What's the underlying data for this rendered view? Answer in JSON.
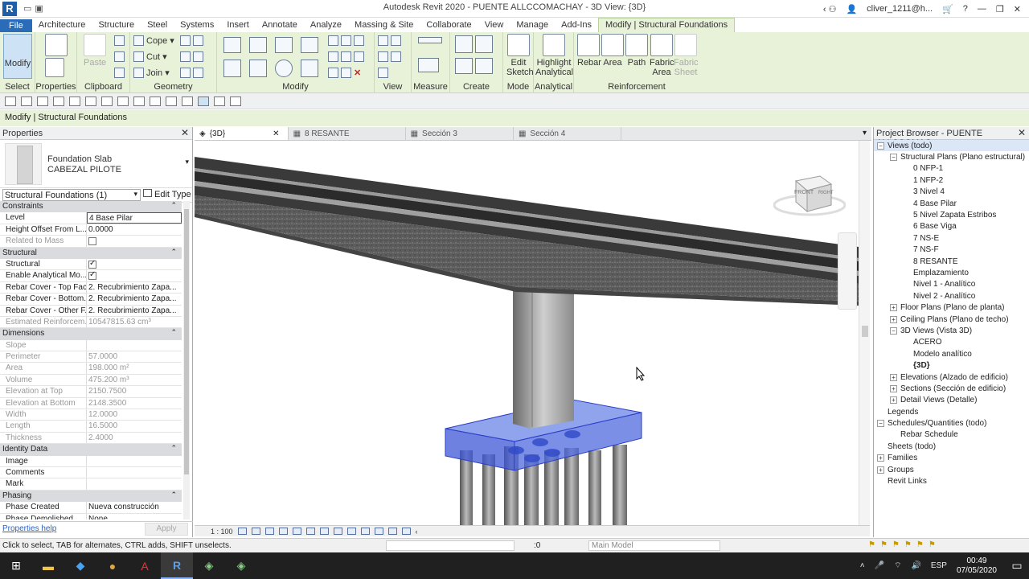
{
  "window": {
    "title": "Autodesk Revit 2020 - PUENTE ALLCCOMACHAY - 3D View: {3D}",
    "user": "cliver_1211@h...",
    "help": "?"
  },
  "tabs": [
    "File",
    "Architecture",
    "Structure",
    "Steel",
    "Systems",
    "Insert",
    "Annotate",
    "Analyze",
    "Massing & Site",
    "Collaborate",
    "View",
    "Manage",
    "Add-Ins",
    "Modify | Structural Foundations"
  ],
  "ribbon": {
    "select": {
      "modify": "Modify",
      "label": "Select"
    },
    "properties": {
      "label": "Properties"
    },
    "clipboard": {
      "paste": "Paste",
      "label": "Clipboard"
    },
    "geometry": {
      "cope": "Cope",
      "cut": "Cut",
      "join": "Join",
      "label": "Geometry"
    },
    "modify": {
      "label": "Modify"
    },
    "view": {
      "label": "View"
    },
    "measure": {
      "label": "Measure"
    },
    "create": {
      "label": "Create"
    },
    "mode": {
      "edit_sketch": "Edit Sketch",
      "label": "Mode"
    },
    "analytical": {
      "highlight": "Highlight Analytical",
      "label": "Analytical"
    },
    "reinforcement": {
      "rebar": "Rebar",
      "area": "Area",
      "path": "Path",
      "fabric_area": "Fabric Area",
      "fabric_sheet": "Fabric Sheet",
      "label": "Reinforcement"
    }
  },
  "options_bar": "Modify | Structural Foundations",
  "properties": {
    "title": "Properties",
    "family": "Foundation Slab",
    "type": "CABEZAL PILOTE",
    "instance_selector": "Structural Foundations (1)",
    "edit_type": "Edit Type",
    "sections": [
      {
        "name": "Constraints",
        "rows": [
          {
            "k": "Level",
            "v": "4 Base Pilar",
            "boxed": true
          },
          {
            "k": "Height Offset From L...",
            "v": "0.0000"
          },
          {
            "k": "Related to Mass",
            "v": "",
            "chk": "off",
            "ro": true
          }
        ]
      },
      {
        "name": "Structural",
        "rows": [
          {
            "k": "Structural",
            "v": "",
            "chk": "on"
          },
          {
            "k": "Enable Analytical Mo...",
            "v": "",
            "chk": "on"
          },
          {
            "k": "Rebar Cover - Top Face",
            "v": "2. Recubrimiento Zapa..."
          },
          {
            "k": "Rebar Cover - Bottom...",
            "v": "2. Recubrimiento Zapa..."
          },
          {
            "k": "Rebar Cover - Other F...",
            "v": "2. Recubrimiento Zapa..."
          },
          {
            "k": "Estimated Reinforcem...",
            "v": "10547815.63 cm³",
            "ro": true
          }
        ]
      },
      {
        "name": "Dimensions",
        "rows": [
          {
            "k": "Slope",
            "v": "",
            "ro": true
          },
          {
            "k": "Perimeter",
            "v": "57.0000",
            "ro": true
          },
          {
            "k": "Area",
            "v": "198.000 m²",
            "ro": true
          },
          {
            "k": "Volume",
            "v": "475.200 m³",
            "ro": true
          },
          {
            "k": "Elevation at Top",
            "v": "2150.7500",
            "ro": true
          },
          {
            "k": "Elevation at Bottom",
            "v": "2148.3500",
            "ro": true
          },
          {
            "k": "Width",
            "v": "12.0000",
            "ro": true
          },
          {
            "k": "Length",
            "v": "16.5000",
            "ro": true
          },
          {
            "k": "Thickness",
            "v": "2.4000",
            "ro": true
          }
        ]
      },
      {
        "name": "Identity Data",
        "rows": [
          {
            "k": "Image",
            "v": ""
          },
          {
            "k": "Comments",
            "v": ""
          },
          {
            "k": "Mark",
            "v": ""
          }
        ]
      },
      {
        "name": "Phasing",
        "rows": [
          {
            "k": "Phase Created",
            "v": "Nueva construcción"
          },
          {
            "k": "Phase Demolished",
            "v": "None"
          }
        ]
      }
    ],
    "help_link": "Properties help",
    "apply": "Apply"
  },
  "view_tabs": [
    {
      "label": "{3D}",
      "active": true
    },
    {
      "label": "8 RESANTE",
      "active": false
    },
    {
      "label": "Sección 3",
      "active": false
    },
    {
      "label": "Sección 4",
      "active": false
    }
  ],
  "viewcube": {
    "front": "FRONT",
    "right": "RIGHT"
  },
  "view_control": {
    "scale": "1 : 100"
  },
  "project_browser": {
    "title": "Project Browser - PUENTE ALLCCOMAC...",
    "nodes": [
      {
        "label": "Views (todo)",
        "lvl": 0,
        "exp": "−",
        "sel": true
      },
      {
        "label": "Structural Plans (Plano estructural)",
        "lvl": 1,
        "exp": "−"
      },
      {
        "label": "0 NFP-1",
        "lvl": 2
      },
      {
        "label": "1 NFP-2",
        "lvl": 2
      },
      {
        "label": "3 Nivel 4",
        "lvl": 2
      },
      {
        "label": "4 Base Pilar",
        "lvl": 2
      },
      {
        "label": "5 Nivel Zapata Estribos",
        "lvl": 2
      },
      {
        "label": "6 Base Viga",
        "lvl": 2
      },
      {
        "label": "7 NS-E",
        "lvl": 2
      },
      {
        "label": "7 NS-F",
        "lvl": 2
      },
      {
        "label": "8 RESANTE",
        "lvl": 2
      },
      {
        "label": "Emplazamiento",
        "lvl": 2
      },
      {
        "label": "Nivel 1 - Analítico",
        "lvl": 2
      },
      {
        "label": "Nivel 2 - Analítico",
        "lvl": 2
      },
      {
        "label": "Floor Plans (Plano de planta)",
        "lvl": 1,
        "exp": "+"
      },
      {
        "label": "Ceiling Plans (Plano de techo)",
        "lvl": 1,
        "exp": "+"
      },
      {
        "label": "3D Views (Vista 3D)",
        "lvl": 1,
        "exp": "−"
      },
      {
        "label": "ACERO",
        "lvl": 2
      },
      {
        "label": "Modelo analítico",
        "lvl": 2
      },
      {
        "label": "{3D}",
        "lvl": 2,
        "bold": true
      },
      {
        "label": "Elevations (Alzado de edificio)",
        "lvl": 1,
        "exp": "+"
      },
      {
        "label": "Sections (Sección de edificio)",
        "lvl": 1,
        "exp": "+"
      },
      {
        "label": "Detail Views (Detalle)",
        "lvl": 1,
        "exp": "+"
      },
      {
        "label": "Legends",
        "lvl": 0
      },
      {
        "label": "Schedules/Quantities (todo)",
        "lvl": 0,
        "exp": "−"
      },
      {
        "label": "Rebar Schedule",
        "lvl": 1
      },
      {
        "label": "Sheets (todo)",
        "lvl": 0
      },
      {
        "label": "Families",
        "lvl": 0,
        "exp": "+"
      },
      {
        "label": "Groups",
        "lvl": 0,
        "exp": "+"
      },
      {
        "label": "Revit Links",
        "lvl": 0
      }
    ]
  },
  "status": {
    "message": "Click to select, TAB for alternates, CTRL adds, SHIFT unselects.",
    "zero": ":0",
    "model": "Main Model"
  },
  "taskbar": {
    "time": "00:49",
    "date": "07/05/2020",
    "lang": "ESP"
  }
}
